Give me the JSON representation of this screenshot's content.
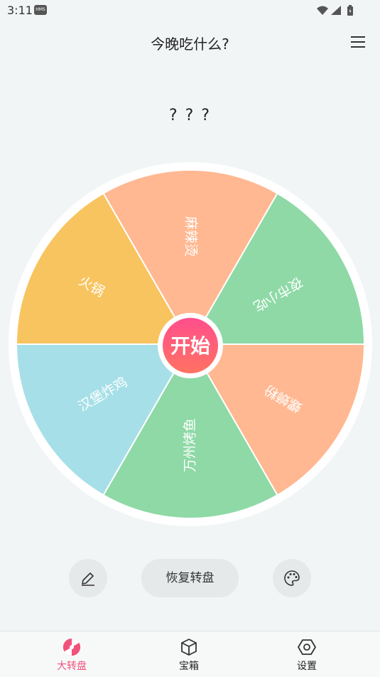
{
  "status_bar": {
    "time": "3:11",
    "badge": "HMS"
  },
  "header": {
    "title": "今晚吃什么?",
    "menu_icon": "menu-icon"
  },
  "result": {
    "text": "? ? ?"
  },
  "wheel": {
    "start_label": "开始",
    "segments": [
      {
        "label": "麻辣烫",
        "color": "#ffb891"
      },
      {
        "label": "夜市小吃",
        "color": "#8ed9a6"
      },
      {
        "label": "螺蛳粉",
        "color": "#ffb891"
      },
      {
        "label": "万州烤鱼",
        "color": "#8ed9a6"
      },
      {
        "label": "汉堡炸鸡",
        "color": "#a6dfe8"
      },
      {
        "label": "火锅",
        "color": "#f8c45f"
      }
    ]
  },
  "actions": {
    "restore_label": "恢复转盘",
    "edit_icon": "pencil-icon",
    "palette_icon": "palette-icon"
  },
  "bottom_nav": {
    "accent": "#f0527c",
    "items": [
      {
        "label": "大转盘",
        "icon": "wheel-icon",
        "active": true
      },
      {
        "label": "宝箱",
        "icon": "box-icon",
        "active": false
      },
      {
        "label": "设置",
        "icon": "settings-icon",
        "active": false
      }
    ]
  }
}
